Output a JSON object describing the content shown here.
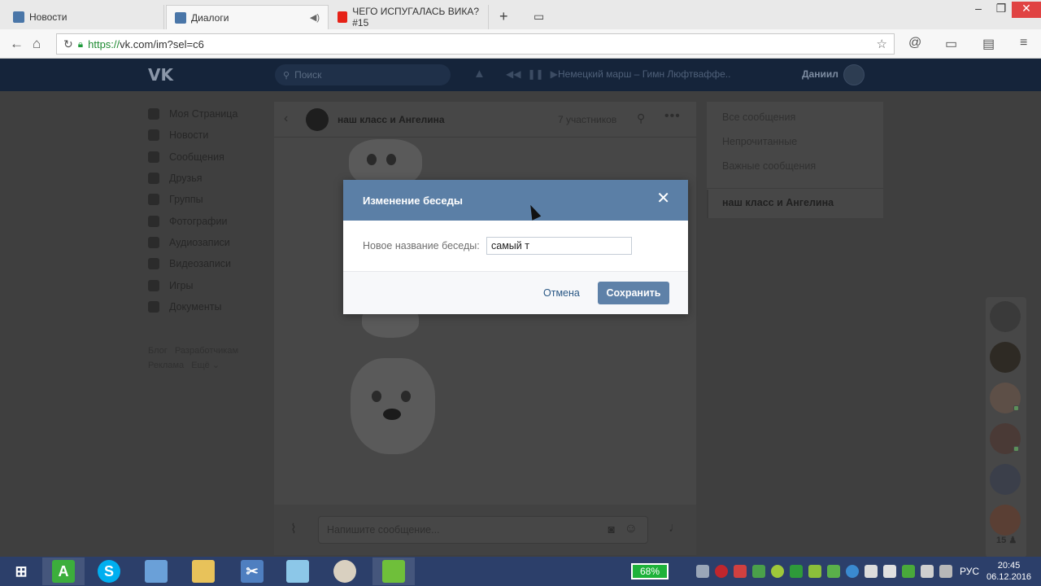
{
  "browser": {
    "tabs": [
      {
        "label": "Новости",
        "favicon": "vk-icon"
      },
      {
        "label": "Диалоги",
        "favicon": "vk-icon"
      },
      {
        "label": "ЧЕГО ИСПУГАЛАСЬ ВИКА? #15",
        "favicon": "youtube-icon"
      }
    ],
    "url_proto": "https://",
    "url_rest": "vk.com/im?sel=c6"
  },
  "vk_header": {
    "logo": "VK",
    "search_placeholder": "Поиск",
    "track": "Немецкий марш – Гимн Люфтваффе..",
    "user_name": "Даниил"
  },
  "left_menu": {
    "items": [
      {
        "label": "Моя Страница"
      },
      {
        "label": "Новости"
      },
      {
        "label": "Сообщения"
      },
      {
        "label": "Друзья"
      },
      {
        "label": "Группы"
      },
      {
        "label": "Фотографии"
      },
      {
        "label": "Аудиозаписи"
      },
      {
        "label": "Видеозаписи"
      },
      {
        "label": "Игры"
      },
      {
        "label": "Документы"
      }
    ],
    "footer_line1_a": "Блог",
    "footer_line1_b": "Разработчикам",
    "footer_line2_a": "Реклама",
    "footer_line2_b": "Ещё"
  },
  "chat": {
    "title": "наш класс и Ангелина",
    "members": "7 участников",
    "input_placeholder": "Напишите сообщение..."
  },
  "right_menu": {
    "items": [
      {
        "label": "Все сообщения"
      },
      {
        "label": "Непрочитанные"
      },
      {
        "label": "Важные сообщения"
      }
    ],
    "active_item": "наш класс и Ангелина"
  },
  "friends": {
    "count": "15"
  },
  "modal": {
    "title": "Изменение беседы",
    "field_label": "Новое название беседы:",
    "field_value": "самый т",
    "cancel_label": "Отмена",
    "save_label": "Сохранить"
  },
  "taskbar": {
    "battery": "68%",
    "language": "РУС",
    "time": "20:45",
    "date": "06.12.2016"
  }
}
